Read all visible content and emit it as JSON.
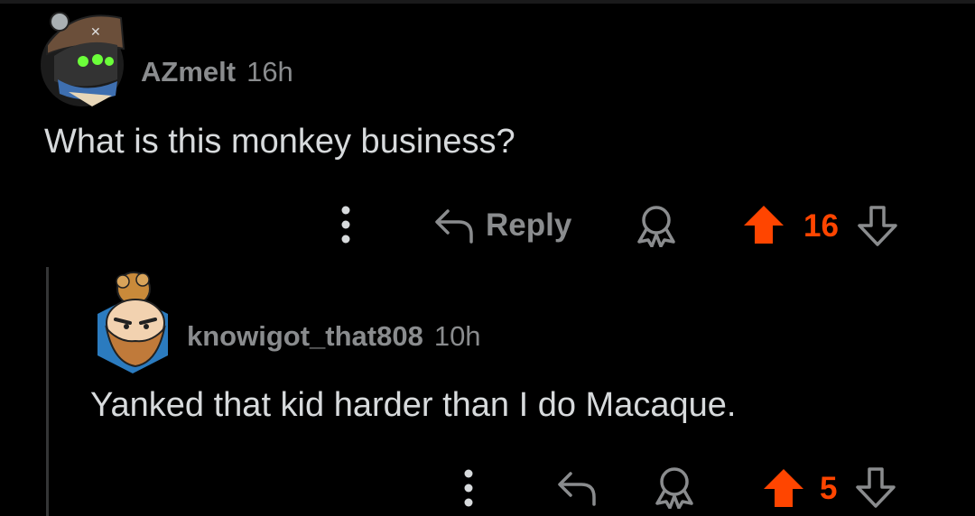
{
  "comments": [
    {
      "username": "AZmelt",
      "time": "16h",
      "body": "What is this monkey business?",
      "reply_label": "Reply",
      "score": "16"
    },
    {
      "username": "knowigot_that808",
      "time": "10h",
      "body": "Yanked that kid harder than I do Macaque.",
      "score": "5"
    }
  ],
  "colors": {
    "background": "#000000",
    "text": "#d7dadc",
    "muted": "#8a8c8e",
    "upvote_active": "#ff4500",
    "thread_line": "#343536"
  },
  "icons": {
    "more": "more-vertical-icon",
    "reply": "reply-arrow-icon",
    "award": "award-icon",
    "upvote": "upvote-arrow-icon",
    "downvote": "downvote-arrow-icon"
  }
}
